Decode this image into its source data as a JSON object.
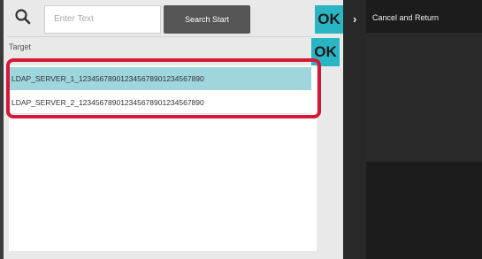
{
  "search": {
    "placeholder": "Enter Text",
    "start_label": "Search Start",
    "ok_label": "OK"
  },
  "target": {
    "label": "Target",
    "ok_label": "OK"
  },
  "list": {
    "items": [
      {
        "label": "LDAP_SERVER_1_12345678901234567890123456789​0",
        "selected": true
      },
      {
        "label": "LDAP_SERVER_2_12345678901234567890123456789​0",
        "selected": false
      }
    ]
  },
  "side_panel": {
    "cancel_label": "Cancel and Return"
  },
  "colors": {
    "accent": "#29b5c4",
    "selected_row": "#9fd6de",
    "highlight": "#d51836",
    "button_dark": "#555555"
  },
  "icons": {
    "search": "search-icon",
    "chevron": "chevron-right-icon"
  }
}
